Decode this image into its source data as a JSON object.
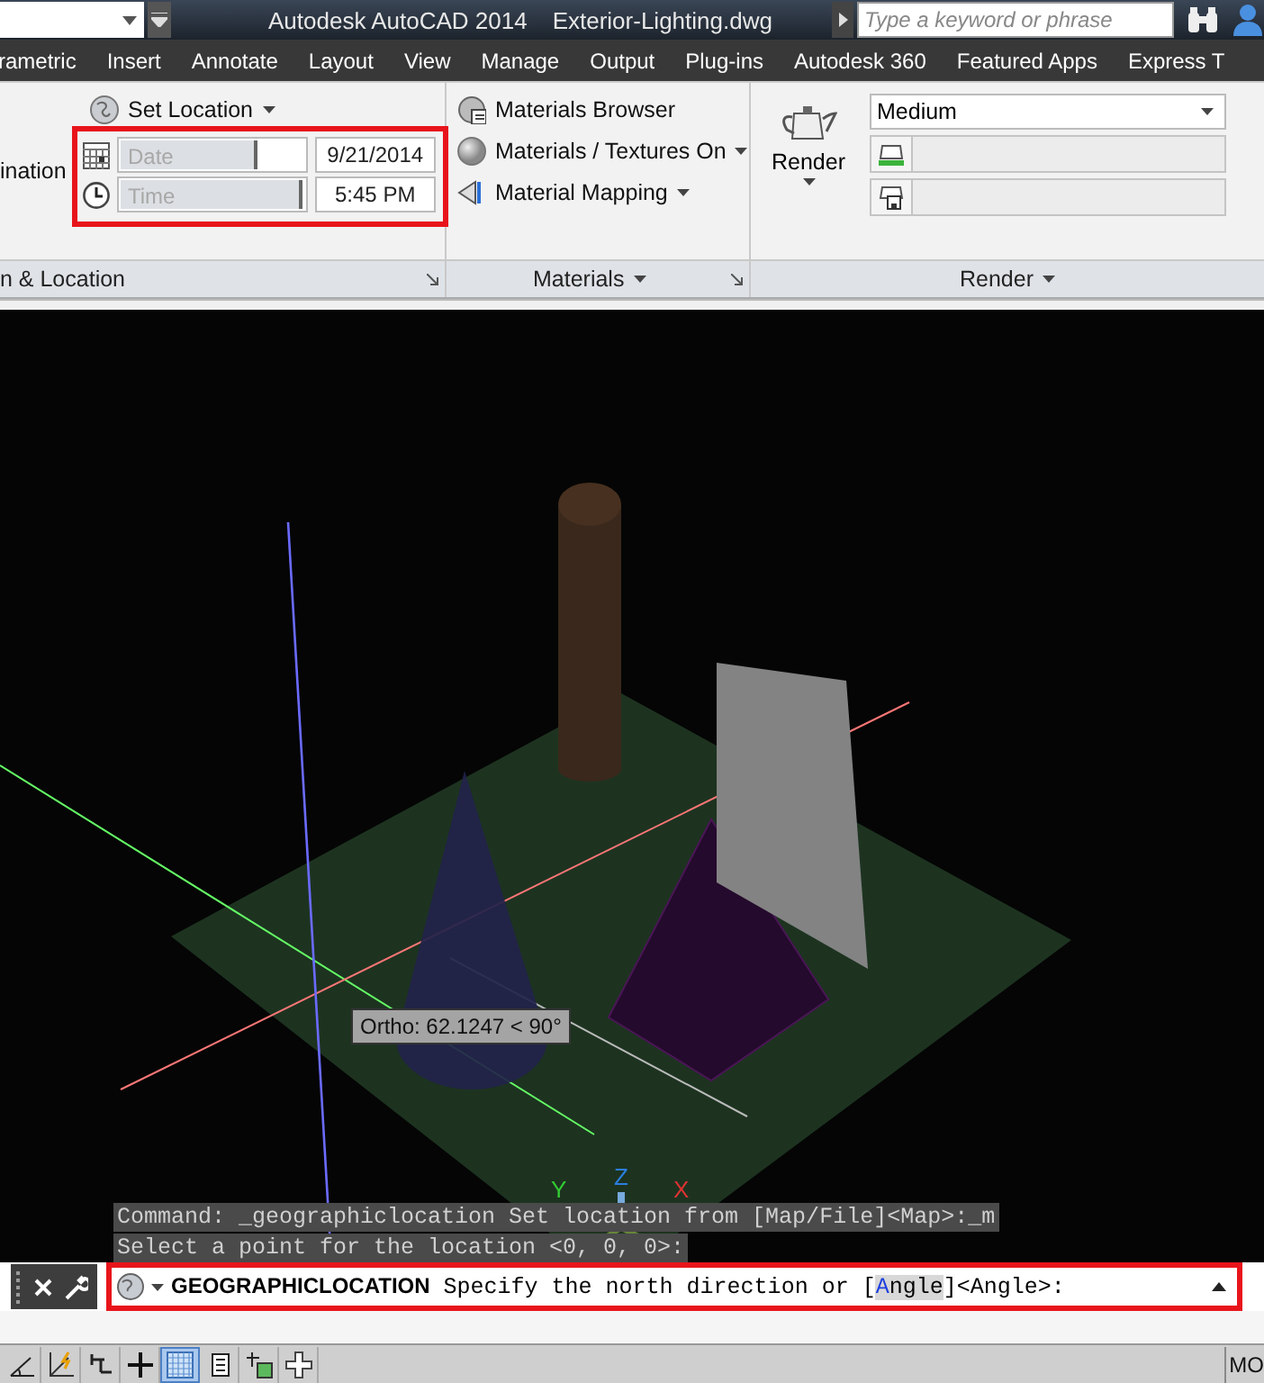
{
  "title_bar": {
    "title": "Autodesk AutoCAD 2014",
    "file": "Exterior-Lighting.dwg",
    "search": {
      "placeholder": "Type a keyword or phrase"
    }
  },
  "ribbon_tabs": [
    "rametric",
    "Insert",
    "Annotate",
    "Layout",
    "View",
    "Manage",
    "Output",
    "Plug-ins",
    "Autodesk 360",
    "Featured Apps",
    "Express T"
  ],
  "ribbon": {
    "sun_panel": {
      "cut_label": "ination",
      "set_location": "Set Location",
      "date": {
        "label": "Date",
        "level": 0.73,
        "value": "9/21/2014"
      },
      "time": {
        "label": "Time",
        "level": 0.97,
        "value": "5:45 PM"
      },
      "title": "n & Location"
    },
    "materials_panel": {
      "items": [
        {
          "label": "Materials Browser",
          "dropdown": false
        },
        {
          "label": "Materials / Textures On",
          "dropdown": true
        },
        {
          "label": "Material Mapping",
          "dropdown": true
        }
      ],
      "title": "Materials"
    },
    "render_panel": {
      "render_button": "Render",
      "quality": "Medium",
      "progress": [
        {
          "level": 0
        },
        {
          "level": 0
        }
      ],
      "title": "Render"
    }
  },
  "viewport": {
    "tooltip": "Ortho: 62.1247 < 90°",
    "axis_x": "X",
    "axis_y": "Y",
    "axis_z": "Z"
  },
  "command_history": [
    "Command: _geographiclocation Set location from [Map/File]<Map>:_m",
    "Select a point for the location <0, 0, 0>:"
  ],
  "command_line": {
    "name": "GEOGRAPHICLOCATION",
    "prompt": "Specify the north direction or [",
    "option_key": "A",
    "option_rest": "ngle",
    "suffix": "]<Angle>:"
  },
  "status_bar": {
    "toggles": [
      {
        "on": false
      },
      {
        "on": false
      },
      {
        "on": false
      },
      {
        "on": false
      },
      {
        "on": true
      },
      {
        "on": false
      },
      {
        "on": false
      },
      {
        "on": false
      }
    ],
    "space": "MO"
  }
}
